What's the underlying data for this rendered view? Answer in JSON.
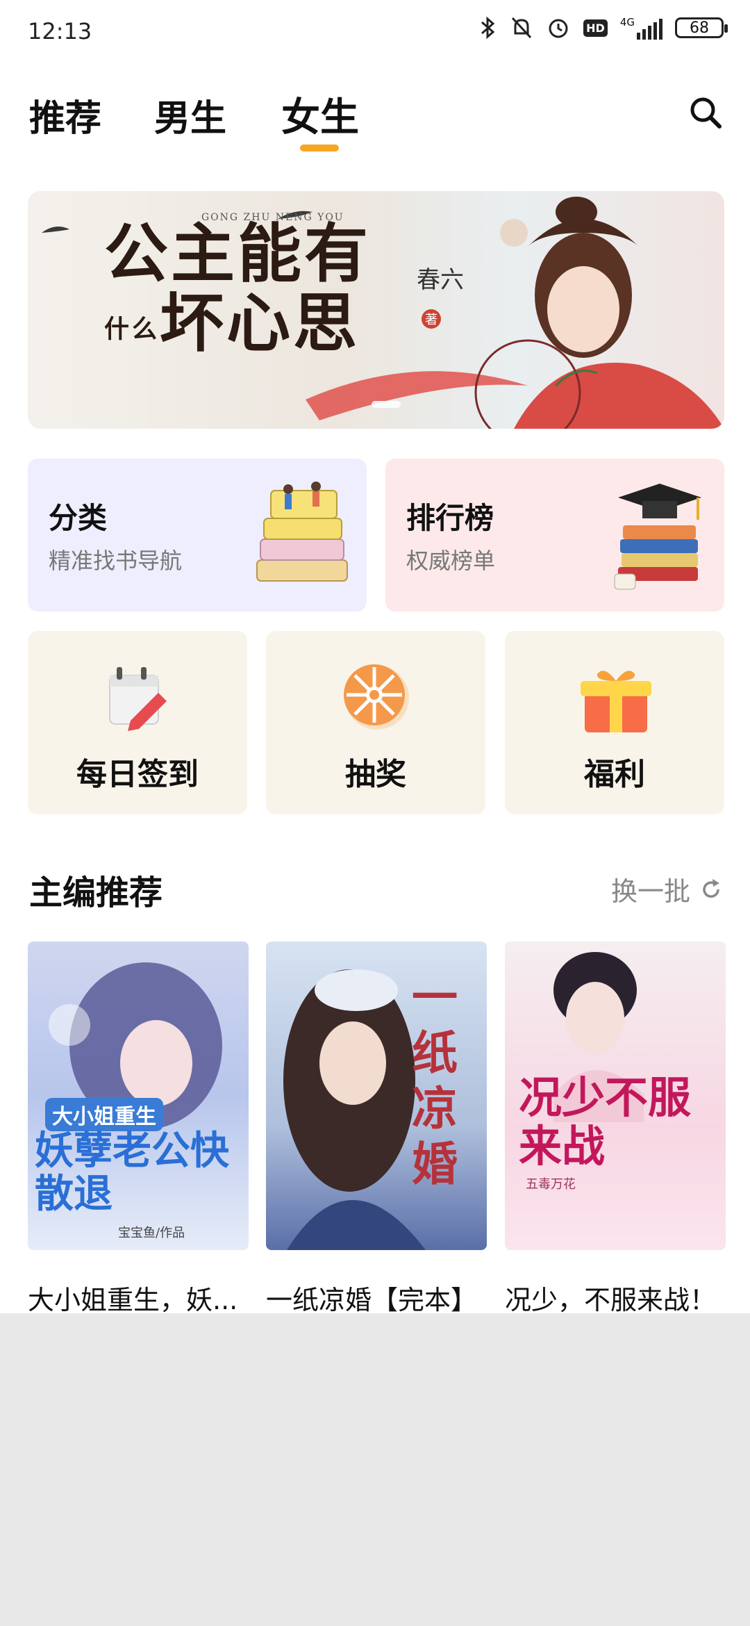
{
  "status_bar": {
    "time": "12:13",
    "network": "4G",
    "battery": "68",
    "hd": "HD"
  },
  "tabs": [
    {
      "label": "推荐",
      "active": false
    },
    {
      "label": "男生",
      "active": false
    },
    {
      "label": "女生",
      "active": true
    }
  ],
  "banner": {
    "title_line1": "公主能有",
    "title_small": "什么",
    "title_line2": "坏心思",
    "subtitle": "GONG ZHU NENG YOU",
    "author": "春六",
    "seal": "著"
  },
  "cards": {
    "category": {
      "title": "分类",
      "subtitle": "精准找书导航"
    },
    "ranking": {
      "title": "排行榜",
      "subtitle": "权威榜单"
    }
  },
  "quick_actions": [
    {
      "label": "每日签到",
      "icon": "calendar-checkin-icon"
    },
    {
      "label": "抽奖",
      "icon": "lottery-wheel-icon"
    },
    {
      "label": "福利",
      "icon": "gift-box-icon"
    }
  ],
  "section": {
    "title": "主编推荐",
    "refresh_label": "换一批"
  },
  "books": [
    {
      "title": "大小姐重生，妖...",
      "cover_small": "大小姐重生",
      "cover_main": "妖孽老公快散退",
      "cover_author": "宝宝鱼/作品"
    },
    {
      "title": "一纸凉婚【完本】",
      "cover_main": "一纸凉婚"
    },
    {
      "title": "况少，不服来战！",
      "cover_main": "况少不服来战",
      "cover_author": "五毒万花"
    }
  ],
  "colors": {
    "accent": "#f6a623",
    "category_bg": "#eeeefe",
    "ranking_bg": "#fde9ea",
    "action_bg": "#f9f4ea"
  }
}
